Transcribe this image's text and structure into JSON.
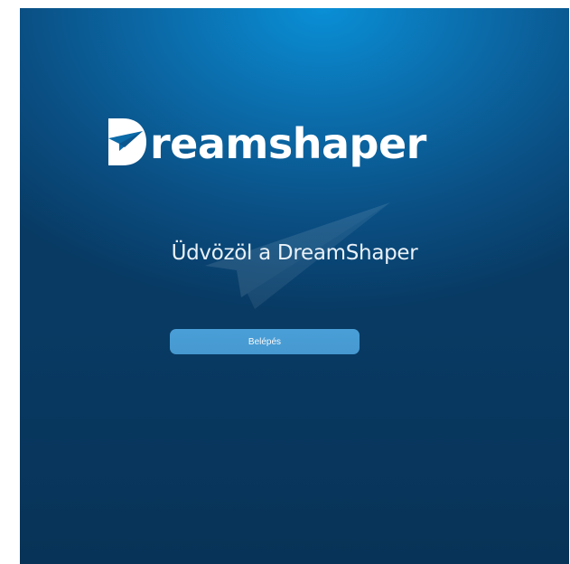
{
  "app": {
    "logo_text": "reamshaper",
    "logo_full": "Dreamshaper"
  },
  "welcome": {
    "heading": "Üdvözöl a DreamShaper"
  },
  "actions": {
    "login_label": "Belépés"
  },
  "colors": {
    "accent": "#4a9fd8",
    "background_top": "#0a8fd6",
    "background_bottom": "#083a63"
  },
  "icons": {
    "logo": "paper-plane-d-logo-icon",
    "watermark": "paper-plane-icon"
  }
}
